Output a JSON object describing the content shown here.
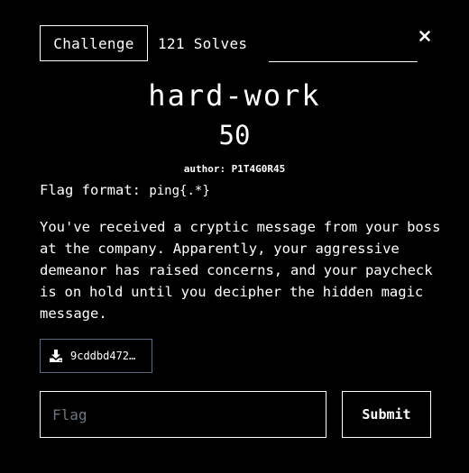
{
  "tabs": {
    "challenge_label": "Challenge",
    "solves_label": "121 Solves"
  },
  "close_glyph": "×",
  "challenge": {
    "name": "hard-work",
    "points": "50",
    "author": "author: P1T4G0R45",
    "flag_format_label": "Flag format:",
    "flag_format_value": "ping{.*}",
    "description": "You've received a cryptic message from your boss at the company. Apparently, your aggressive demeanor has raised concerns, and your paycheck is on hold until you decipher the hidden magic message."
  },
  "file": {
    "icon": "download-icon",
    "name": "9cddbd472…"
  },
  "flag_input": {
    "placeholder": "Flag",
    "value": ""
  },
  "submit_label": "Submit",
  "colors": {
    "background": "#000000",
    "foreground": "#ffffff",
    "file_border": "#5b6b80",
    "placeholder": "#6c757d"
  }
}
